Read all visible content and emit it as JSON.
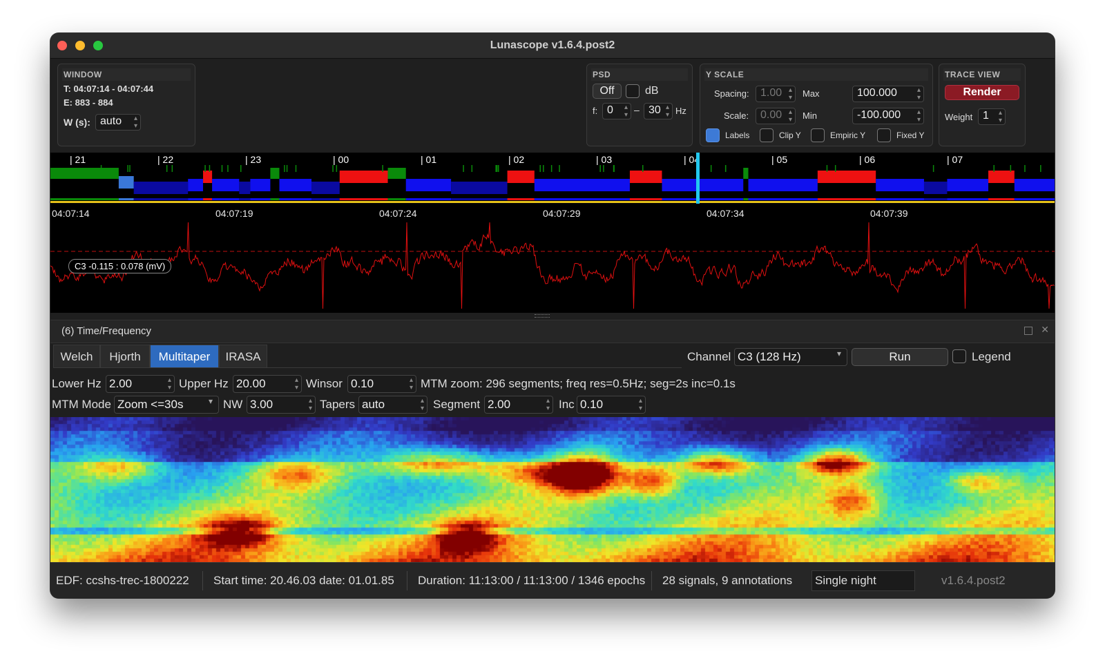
{
  "window": {
    "title": "Lunascope v1.6.4.post2",
    "traffic_colors": [
      "#fe5f57",
      "#febc2e",
      "#28c840"
    ]
  },
  "window_panel": {
    "header": "WINDOW",
    "time_range": "T: 04:07:14 - 04:07:44",
    "epoch_range": "E: 883 - 884",
    "w_label": "W (s):",
    "w_value": "auto"
  },
  "psd_panel": {
    "header": "PSD",
    "off_label": "Off",
    "db_label": "dB",
    "f_label": "f:",
    "f_min": "0",
    "dash": "–",
    "f_max": "30",
    "hz_label": "Hz"
  },
  "yscale_panel": {
    "header": "Y SCALE",
    "spacing_label": "Spacing:",
    "spacing_value": "1.00",
    "max_label": "Max",
    "max_value": "100.000",
    "scale_label": "Scale:",
    "scale_value": "0.00",
    "min_label": "Min",
    "min_value": "-100.000",
    "labels_label": "Labels",
    "labels_checked": true,
    "clip_label": "Clip Y",
    "empiric_label": "Empiric Y",
    "fixed_label": "Fixed Y"
  },
  "trace_panel": {
    "header": "TRACE VIEW",
    "render_label": "Render",
    "weight_label": "Weight",
    "weight_value": "1"
  },
  "hypnogram": {
    "hour_ticks": [
      "| 21",
      "| 22",
      "| 23",
      "| 00",
      "| 01",
      "| 02",
      "| 03",
      "| 04",
      "| 05",
      "| 06",
      "| 07"
    ],
    "stage_colors": {
      "wake": "#0a8a0a",
      "rem": "#ee1111",
      "n1": "#3a78d8",
      "n2": "#1010ee",
      "n3": "#0a0aa0"
    },
    "cursor_color": "#22c8f0",
    "segments": [
      {
        "s": "wake",
        "a": 0.0,
        "b": 0.068
      },
      {
        "s": "n1",
        "a": 0.068,
        "b": 0.083
      },
      {
        "s": "n3",
        "a": 0.083,
        "b": 0.137
      },
      {
        "s": "n2",
        "a": 0.137,
        "b": 0.152
      },
      {
        "s": "rem",
        "a": 0.152,
        "b": 0.161
      },
      {
        "s": "n2",
        "a": 0.161,
        "b": 0.188
      },
      {
        "s": "n3",
        "a": 0.188,
        "b": 0.199
      },
      {
        "s": "n2",
        "a": 0.199,
        "b": 0.219
      },
      {
        "s": "wake",
        "a": 0.219,
        "b": 0.228
      },
      {
        "s": "n2",
        "a": 0.228,
        "b": 0.26
      },
      {
        "s": "n3",
        "a": 0.26,
        "b": 0.288
      },
      {
        "s": "rem",
        "a": 0.288,
        "b": 0.336
      },
      {
        "s": "wake",
        "a": 0.336,
        "b": 0.354
      },
      {
        "s": "n2",
        "a": 0.354,
        "b": 0.399
      },
      {
        "s": "n3",
        "a": 0.399,
        "b": 0.455
      },
      {
        "s": "rem",
        "a": 0.455,
        "b": 0.482
      },
      {
        "s": "n2",
        "a": 0.482,
        "b": 0.577
      },
      {
        "s": "rem",
        "a": 0.577,
        "b": 0.609
      },
      {
        "s": "n2",
        "a": 0.609,
        "b": 0.69
      },
      {
        "s": "wake",
        "a": 0.69,
        "b": 0.695
      },
      {
        "s": "n2",
        "a": 0.695,
        "b": 0.764
      },
      {
        "s": "rem",
        "a": 0.764,
        "b": 0.822
      },
      {
        "s": "n2",
        "a": 0.822,
        "b": 0.87
      },
      {
        "s": "n3",
        "a": 0.87,
        "b": 0.893
      },
      {
        "s": "n2",
        "a": 0.893,
        "b": 0.934
      },
      {
        "s": "rem",
        "a": 0.934,
        "b": 0.96
      },
      {
        "s": "n2",
        "a": 0.96,
        "b": 1.0
      }
    ]
  },
  "trace": {
    "time_labels": [
      "04:07:14",
      "04:07:19",
      "04:07:24",
      "04:07:29",
      "04:07:34",
      "04:07:39"
    ],
    "channel_label": "C3 -0.115 : 0.078 (mV)",
    "trace_color": "#e01010"
  },
  "tf_panel": {
    "title": "(6) Time/Frequency",
    "tabs": [
      "Welch",
      "Hjorth",
      "Multitaper",
      "IRASA"
    ],
    "selected_tab": "Multitaper",
    "channel_label": "Channel",
    "channel_value": "C3 (128 Hz)",
    "run_label": "Run",
    "legend_label": "Legend",
    "lower_label": "Lower Hz",
    "lower_value": "2.00",
    "upper_label": "Upper Hz",
    "upper_value": "20.00",
    "winsor_label": "Winsor",
    "winsor_value": "0.10",
    "zoom_info": "MTM zoom: 296 segments; freq res=0.5Hz; seg=2s inc=0.1s",
    "mode_label": "MTM Mode",
    "mode_value": "Zoom <=30s",
    "nw_label": "NW",
    "nw_value": "3.00",
    "tapers_label": "Tapers",
    "tapers_value": "auto",
    "segment_label": "Segment",
    "segment_value": "2.00",
    "inc_label": "Inc",
    "inc_value": "0.10"
  },
  "status": {
    "edf": "EDF: ccshs-trec-1800222",
    "start": "Start time: 20.46.03 date: 01.01.85",
    "duration": "Duration: 11:13:00 / 11:13:00 / 1346 epochs",
    "signals": "28 signals, 9 annotations",
    "mode": "Single night",
    "version": "v1.6.4.post2"
  }
}
